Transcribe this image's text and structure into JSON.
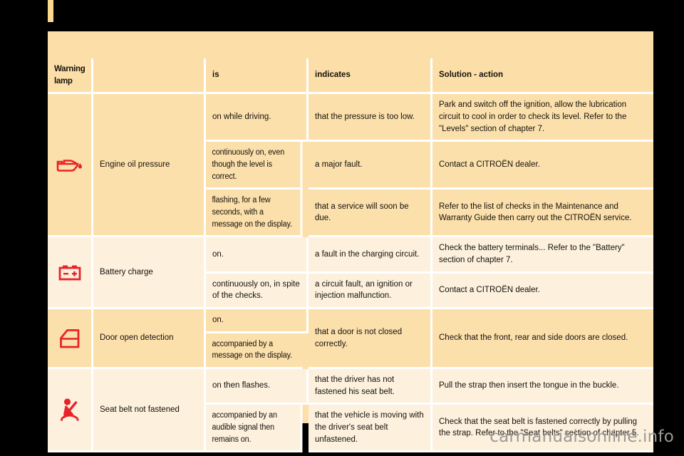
{
  "page": {
    "watermark": "carmanualsonline.info",
    "accent_red": "#E8232A",
    "band_dark": "#FCE0AC",
    "band_light": "#FDF1DE",
    "grid_color": "#FFFFFF",
    "page_background": "#FCE0AC"
  },
  "table": {
    "headers": {
      "lamp": "Warning lamp",
      "name": "",
      "is": "is",
      "indicates": "indicates",
      "solution": "Solution - action"
    },
    "rows": [
      {
        "icon": "oil-can-icon",
        "name": "Engine oil pressure",
        "band": "dark",
        "states": [
          {
            "is": "on while driving.",
            "indicates": "that the pressure is too low.",
            "solution": "Park and switch off the ignition, allow the lubrication circuit to cool in order to check its level. Refer to the \"Levels\" section of chapter 7."
          },
          {
            "is": "continuously on, even though the level is correct.",
            "indicates": "a major fault.",
            "solution": "Contact a CITROËN dealer."
          },
          {
            "is": "flashing, for a few seconds, with a message on the display.",
            "indicates": "that a service will soon be due.",
            "solution": "Refer to the list of checks in the Maintenance and Warranty Guide then carry out the CITROËN service."
          }
        ]
      },
      {
        "icon": "battery-icon",
        "name": "Battery charge",
        "band": "light",
        "states": [
          {
            "is": "on.",
            "indicates": "a fault in the charging circuit.",
            "solution": "Check the battery terminals... Refer to the \"Battery\" section of chapter 7."
          },
          {
            "is": "continuously on, in spite of the checks.",
            "indicates": "a circuit fault, an ignition or injection malfunction.",
            "solution": "Contact a CITROËN dealer."
          }
        ]
      },
      {
        "icon": "car-door-icon",
        "name": "Door open detection",
        "band": "dark",
        "merged": true,
        "states": [
          {
            "is": "on."
          },
          {
            "is": "accompanied by a message on the display."
          }
        ],
        "indicates": "that a door is not closed correctly.",
        "solution": "Check that the front, rear and side doors are closed."
      },
      {
        "icon": "seat-belt-icon",
        "name": "Seat belt not fastened",
        "band": "light",
        "states": [
          {
            "is": "on then flashes.",
            "indicates": "that the driver has not fastened his seat belt.",
            "solution": "Pull the strap then insert the tongue in the buckle."
          },
          {
            "is": "accompanied by an audible signal then remains on.",
            "indicates": "that the vehicle is moving with the driver's seat belt unfastened.",
            "solution": "Check that the seat belt is fastened correctly by pulling the strap. Refer to the \"Seat belts\" section of chapter 5."
          }
        ]
      }
    ]
  }
}
